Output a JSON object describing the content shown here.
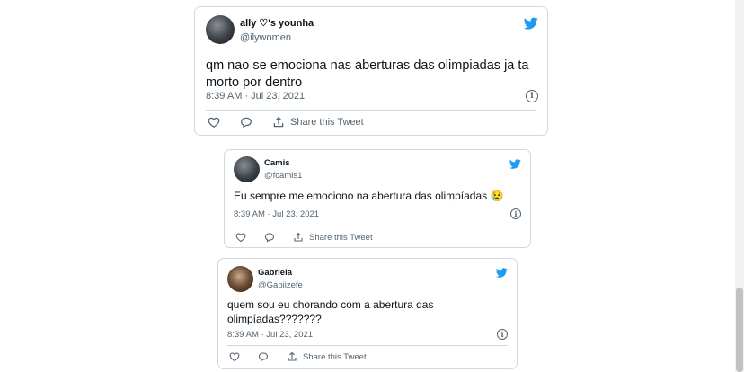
{
  "tweets": [
    {
      "display_name": "ally ♡'s younha",
      "handle": "@ilywomen",
      "text": "qm nao se emociona nas aberturas das olimpiadas ja ta\nmorto por dentro",
      "timestamp": "8:39 AM · Jul 23, 2021",
      "share_label": "Share this Tweet"
    },
    {
      "display_name": "Camis",
      "handle": "@fcamis1",
      "text": "Eu sempre me emociono na abertura das olimpíadas 😢",
      "timestamp": "8:39 AM · Jul 23, 2021",
      "share_label": "Share this Tweet"
    },
    {
      "display_name": "Gabriela",
      "handle": "@Gabiizefe",
      "text": "quem sou eu chorando com a abertura das\nolimpíadas???????",
      "timestamp": "8:39 AM · Jul 23, 2021",
      "share_label": "Share this Tweet"
    }
  ],
  "colors": {
    "twitter_blue": "#1d9bf0",
    "border": "#cfd9de",
    "secondary_text": "#536471"
  },
  "icons": [
    "twitter-bird-icon",
    "heart-icon",
    "reply-icon",
    "share-icon",
    "info-icon"
  ]
}
